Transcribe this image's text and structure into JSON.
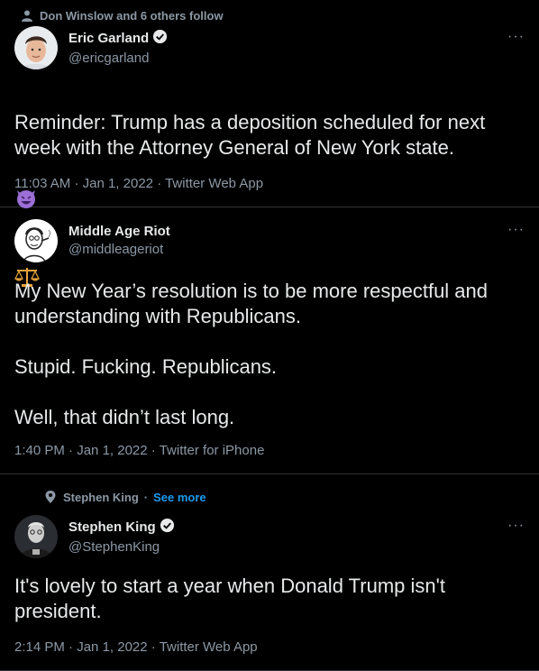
{
  "tweets": [
    {
      "social_context": "Don Winslow and 6 others follow",
      "social_icon": "person-icon",
      "display_name": "Eric Garland",
      "verified": true,
      "handle": "@ericgarland",
      "text_line1": "Reminder: Trump has a deposition scheduled for next week with the Attorney General of New York state.",
      "emoji_1": "smiling-devil-emoji",
      "emoji_2": "balance-scale-emoji",
      "time": "11:03 AM",
      "date": "Jan 1, 2022",
      "source": "Twitter Web App",
      "more": "···"
    },
    {
      "display_name": "Middle Age Riot",
      "verified": false,
      "handle": "@middleageriot",
      "text": "My New Year’s resolution is to be more respectful and understanding with Republicans.\n\nStupid. Fucking. Republicans.\n\nWell, that didn’t last long.",
      "time": "1:40 PM",
      "date": "Jan 1, 2022",
      "source": "Twitter for iPhone",
      "more": "···"
    },
    {
      "social_context": "Stephen King",
      "social_sep": "·",
      "social_link": "See more",
      "social_icon": "topic-pin-icon",
      "display_name": "Stephen King",
      "verified": true,
      "handle": "@StephenKing",
      "text": "It's lovely to start a year when Donald Trump isn't president.",
      "time": "2:14 PM",
      "date": "Jan 1, 2022",
      "source": "Twitter Web App",
      "more": "···"
    }
  ],
  "separator": "·",
  "colors": {
    "background": "#000000",
    "text": "#e7e9ea",
    "secondary": "#8b98a5",
    "accent": "#1d9bf0",
    "divider": "#2f3336"
  }
}
